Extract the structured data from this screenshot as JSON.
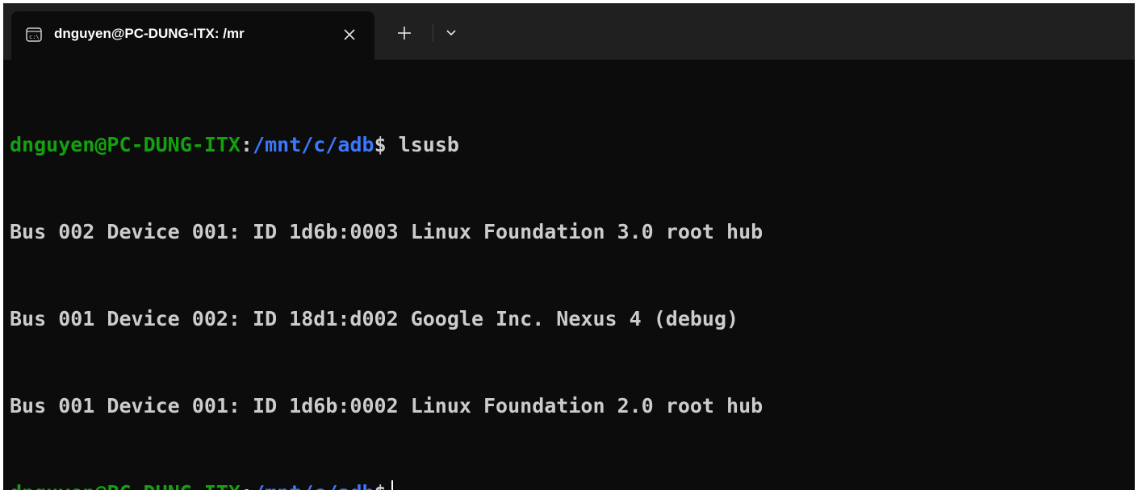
{
  "tab": {
    "title": "dnguyen@PC-DUNG-ITX: /mr",
    "icon": "terminal-icon",
    "close_icon": "close-icon"
  },
  "toolbar": {
    "new_tab_icon": "plus-icon",
    "dropdown_icon": "chevron-down-icon"
  },
  "colors": {
    "background": "#0c0c0c",
    "titlebar": "#202020",
    "prompt_user": "#13a10e",
    "prompt_path": "#3b78ff",
    "text": "#cccccc"
  },
  "terminal": {
    "prompt_user": "dnguyen@PC-DUNG-ITX",
    "prompt_colon": ":",
    "prompt_path": "/mnt/c/adb",
    "prompt_symbol": "$",
    "command": " lsusb",
    "output": [
      "Bus 002 Device 001: ID 1d6b:0003 Linux Foundation 3.0 root hub",
      "Bus 001 Device 002: ID 18d1:d002 Google Inc. Nexus 4 (debug)",
      "Bus 001 Device 001: ID 1d6b:0002 Linux Foundation 2.0 root hub"
    ]
  }
}
